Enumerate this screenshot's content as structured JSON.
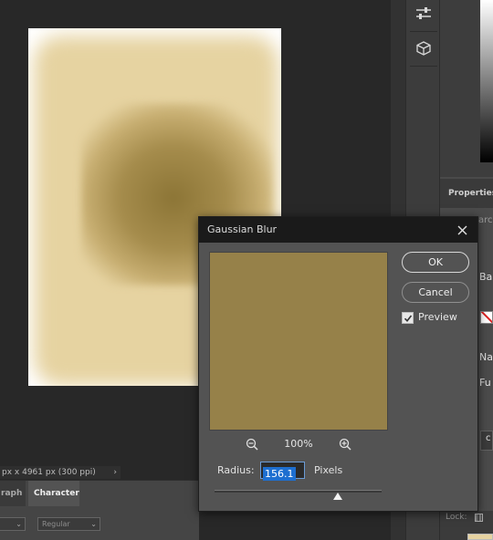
{
  "status_bar": {
    "text": "px x 4961 px (300 ppi)",
    "arrow": "›"
  },
  "bottom_panel": {
    "tabs": [
      "raph",
      "Character"
    ],
    "font_style": "Regular"
  },
  "right_panel": {
    "properties_tab": "Properties",
    "visible_fragments": [
      "arch",
      "Ba",
      "Na",
      "Fu",
      "c"
    ]
  },
  "layers_panel": {
    "locks_label": "Lock:"
  },
  "tools": [
    "adjustments-icon",
    "cube-3d-icon"
  ],
  "dialog": {
    "title": "Gaussian Blur",
    "ok_label": "OK",
    "cancel_label": "Cancel",
    "preview_label": "Preview",
    "preview_checked": true,
    "zoom_level": "100%",
    "radius_label": "Radius:",
    "radius_value": "156.1",
    "radius_units": "Pixels",
    "radius_slider_fraction": 0.74,
    "preview_color": "#968149"
  },
  "colors": {
    "canvas_light": "#e6d3a1",
    "canvas_dark": "#8c7536",
    "accent": "#1e6fd0"
  }
}
